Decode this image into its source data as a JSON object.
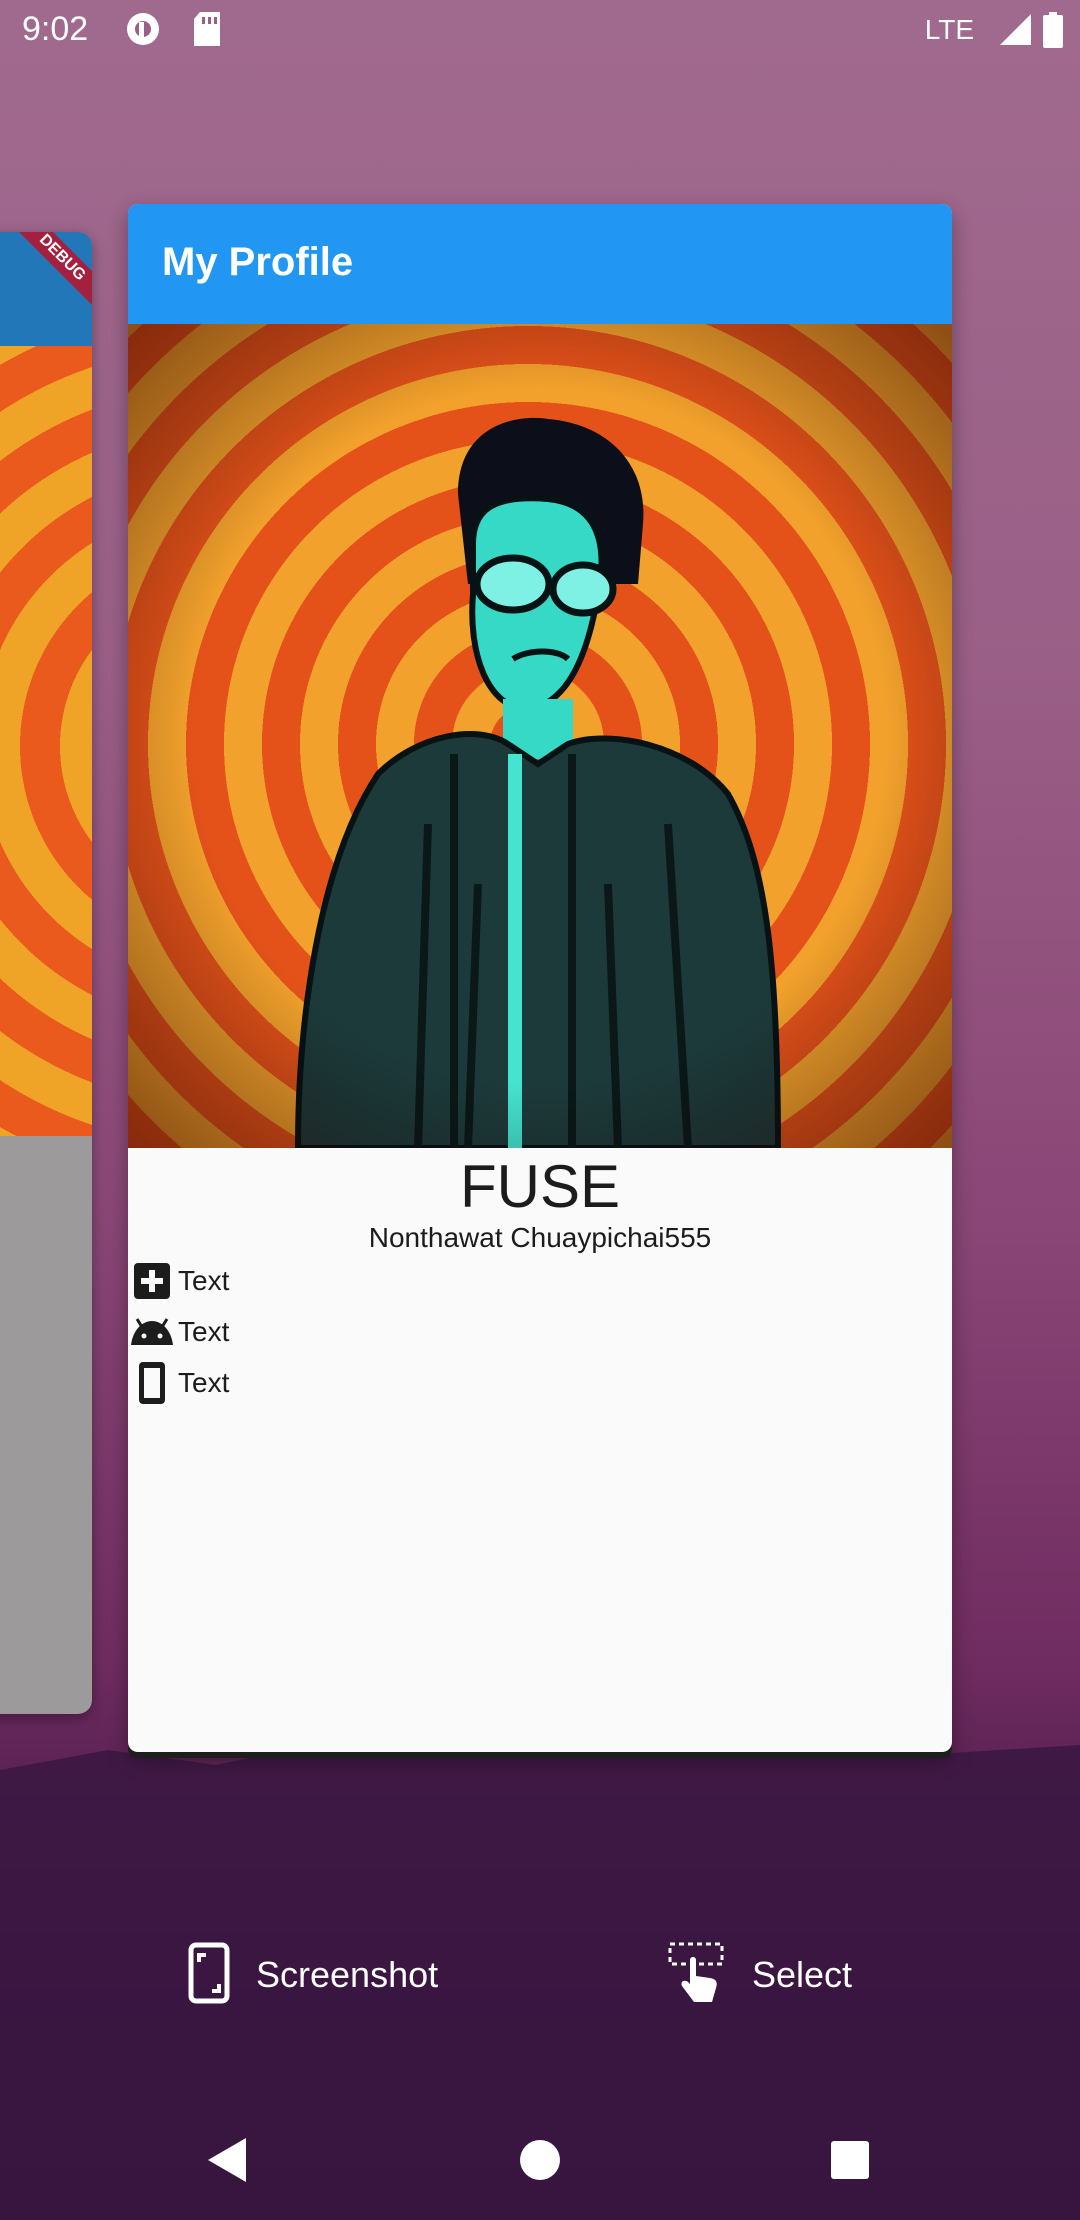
{
  "status_bar": {
    "time": "9:02",
    "network": "LTE",
    "icons": [
      "pocket-casts-icon",
      "sd-card-icon",
      "signal-icon",
      "battery-icon"
    ]
  },
  "background_app": {
    "ribbon": "DEBUG"
  },
  "app": {
    "title": "My Profile",
    "accent_color": "#2196f3",
    "profile": {
      "name": "FUSE",
      "full_name": "Nonthawat Chuaypichai555"
    },
    "rows": [
      {
        "icon": "add-box-icon",
        "text": "Text"
      },
      {
        "icon": "android-icon",
        "text": "Text"
      },
      {
        "icon": "phone-icon",
        "text": "Text"
      }
    ]
  },
  "overview": {
    "screenshot_label": "Screenshot",
    "select_label": "Select"
  },
  "navigation": {
    "back": "back-icon",
    "home": "home-icon",
    "recents": "recents-icon"
  }
}
